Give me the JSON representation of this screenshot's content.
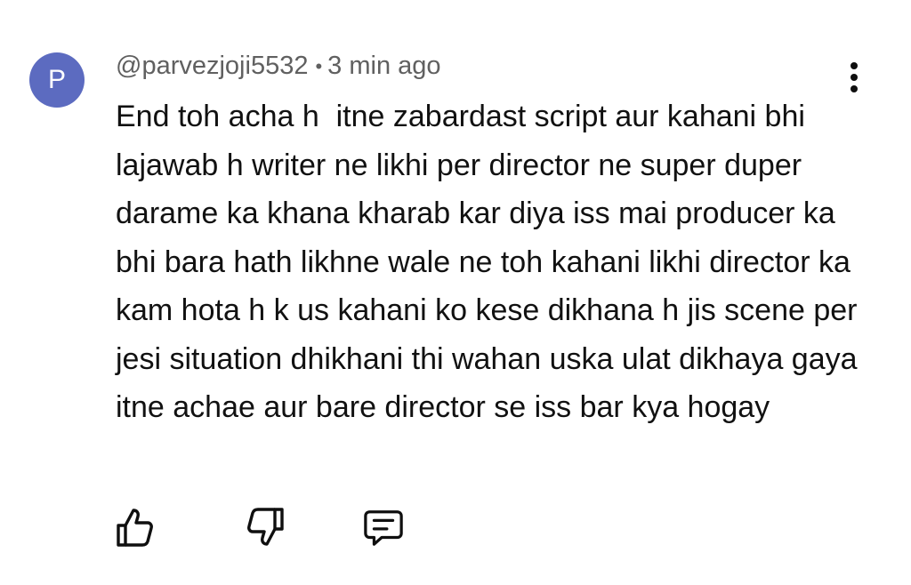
{
  "comment": {
    "avatar_letter": "P",
    "avatar_color": "#5c6bc0",
    "username": "@parvezjoji5532",
    "separator": "•",
    "timestamp": "3 min ago",
    "text": "End toh acha h  itne zabardast script aur kahani bhi lajawab h writer ne likhi per director ne super duper darame ka khana kharab kar diya iss mai producer ka bhi bara hath likhne wale ne toh kahani likhi director ka kam hota h k us kahani ko kese dikhana h jis scene per jesi situation dhikhani thi wahan uska ulat dikhaya gaya itne achae aur bare director se iss bar kya hogay"
  },
  "actions": {
    "like_icon": "thumbs-up-icon",
    "dislike_icon": "thumbs-down-icon",
    "reply_icon": "reply-comment-icon",
    "more_icon": "more-vertical-icon"
  }
}
